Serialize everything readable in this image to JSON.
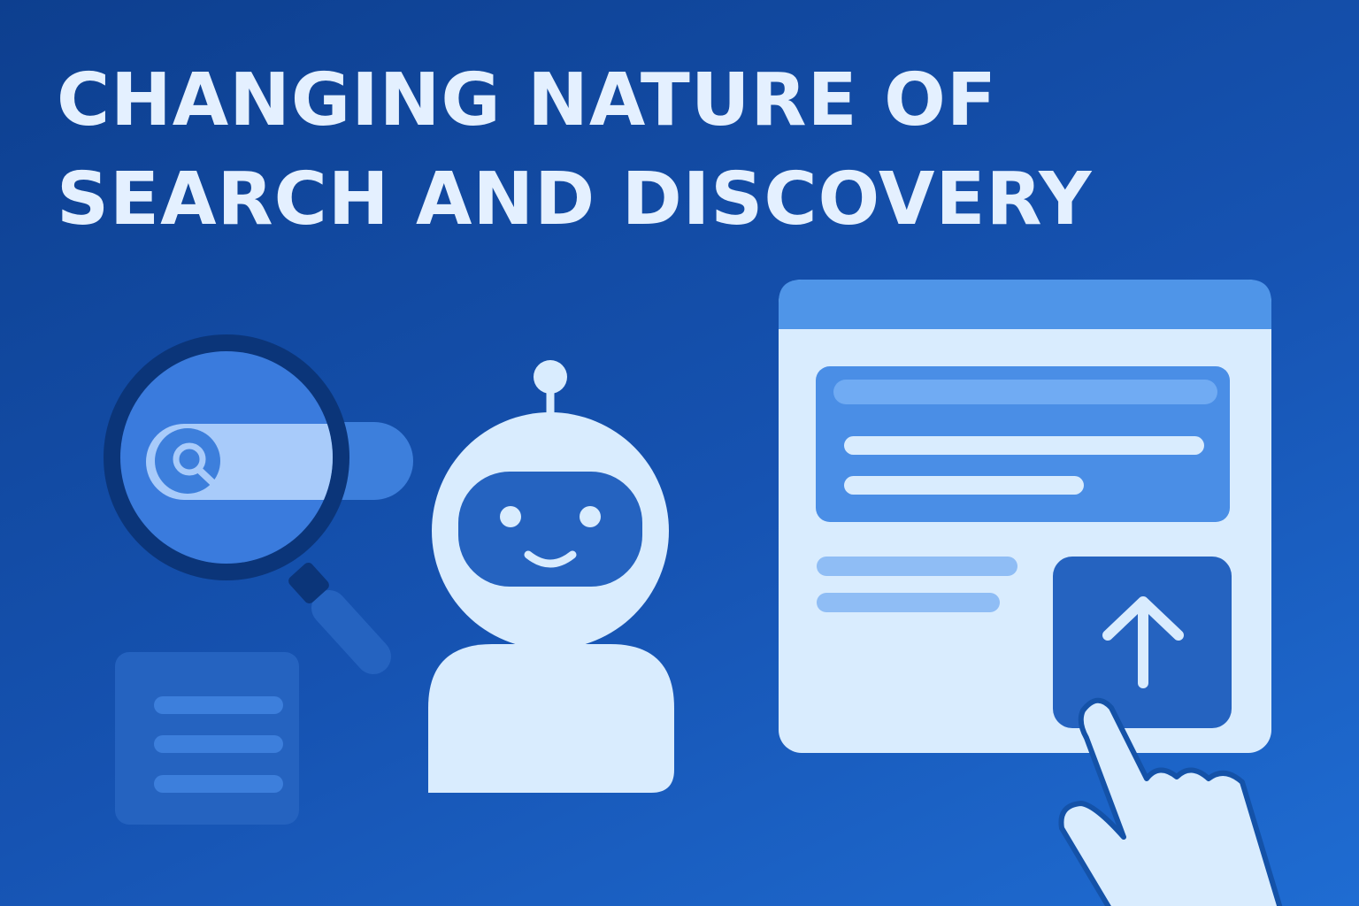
{
  "title": {
    "line1": "CHANGING NATURE OF",
    "line2": "SEARCH AND DISCOVERY"
  },
  "icons": {
    "magnifier": "magnifying-glass-icon",
    "search_bar": "search-bar-icon",
    "document": "document-icon",
    "robot": "robot-icon",
    "browser": "browser-window-icon",
    "upload_button": "arrow-up-icon",
    "hand": "pointing-hand-icon"
  },
  "colors": {
    "background_dark": "#0d3f8f",
    "background_light": "#1f6cd2",
    "title_text": "#e4f0ff",
    "light_fill": "#d9ecfe",
    "accent_blue": "#3d7fdc",
    "mid_blue": "#2563c0",
    "dark_ring": "#0b3579"
  }
}
